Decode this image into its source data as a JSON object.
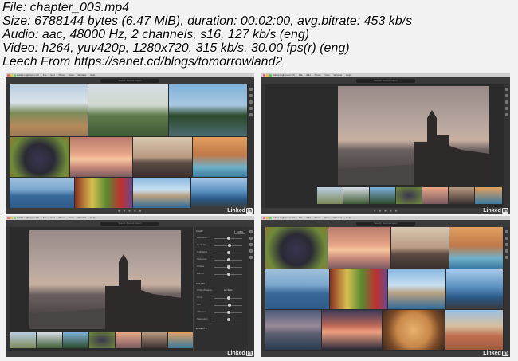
{
  "header": {
    "line1": "File: chapter_003.mp4",
    "line2": "Size: 6788144 bytes (6.47 MiB), duration: 00:02:00, avg.bitrate: 453 kb/s",
    "line3": "Audio: aac, 48000 Hz, 2 channels, s16, 127 kb/s (eng)",
    "line4": "Video: h264, yuv420p, 1280x720, 315 kb/s, 30.00 fps(r) (eng)",
    "line5": "Leech From https://sanet.cd/blogs/tomorrowland2"
  },
  "app": {
    "title": "Adobe Lightroom CC",
    "menus": [
      "File",
      "Edit",
      "Photo",
      "View",
      "Window",
      "Help"
    ],
    "search_placeholder": "Search Recent Import",
    "brand": "Linked",
    "brand_in": "in",
    "stars": "★ ★ ★ ★ ★"
  },
  "edit_panel": {
    "light_label": "LIGHT",
    "auto_label": "AUTO",
    "color_label": "COLOR",
    "effects_label": "EFFECTS",
    "sliders": [
      "Exposure",
      "Contrast",
      "Highlights",
      "Shadows",
      "Whites",
      "Blacks"
    ],
    "color_sliders": [
      "White Balance",
      "Temp",
      "Tint",
      "Vibrance",
      "Saturation"
    ],
    "wb_value": "As Shot",
    "slider_levels": [
      0.5,
      0.55,
      0.5,
      0.5,
      0.52,
      0.5
    ],
    "color_levels": [
      0.5,
      0.55,
      0.5,
      0.5
    ]
  },
  "colors": {
    "dark_bg": "#2b2b2b",
    "sunset": "#e8a07a",
    "sky": "#6fa6d0",
    "sea": "#3f6f9a"
  }
}
